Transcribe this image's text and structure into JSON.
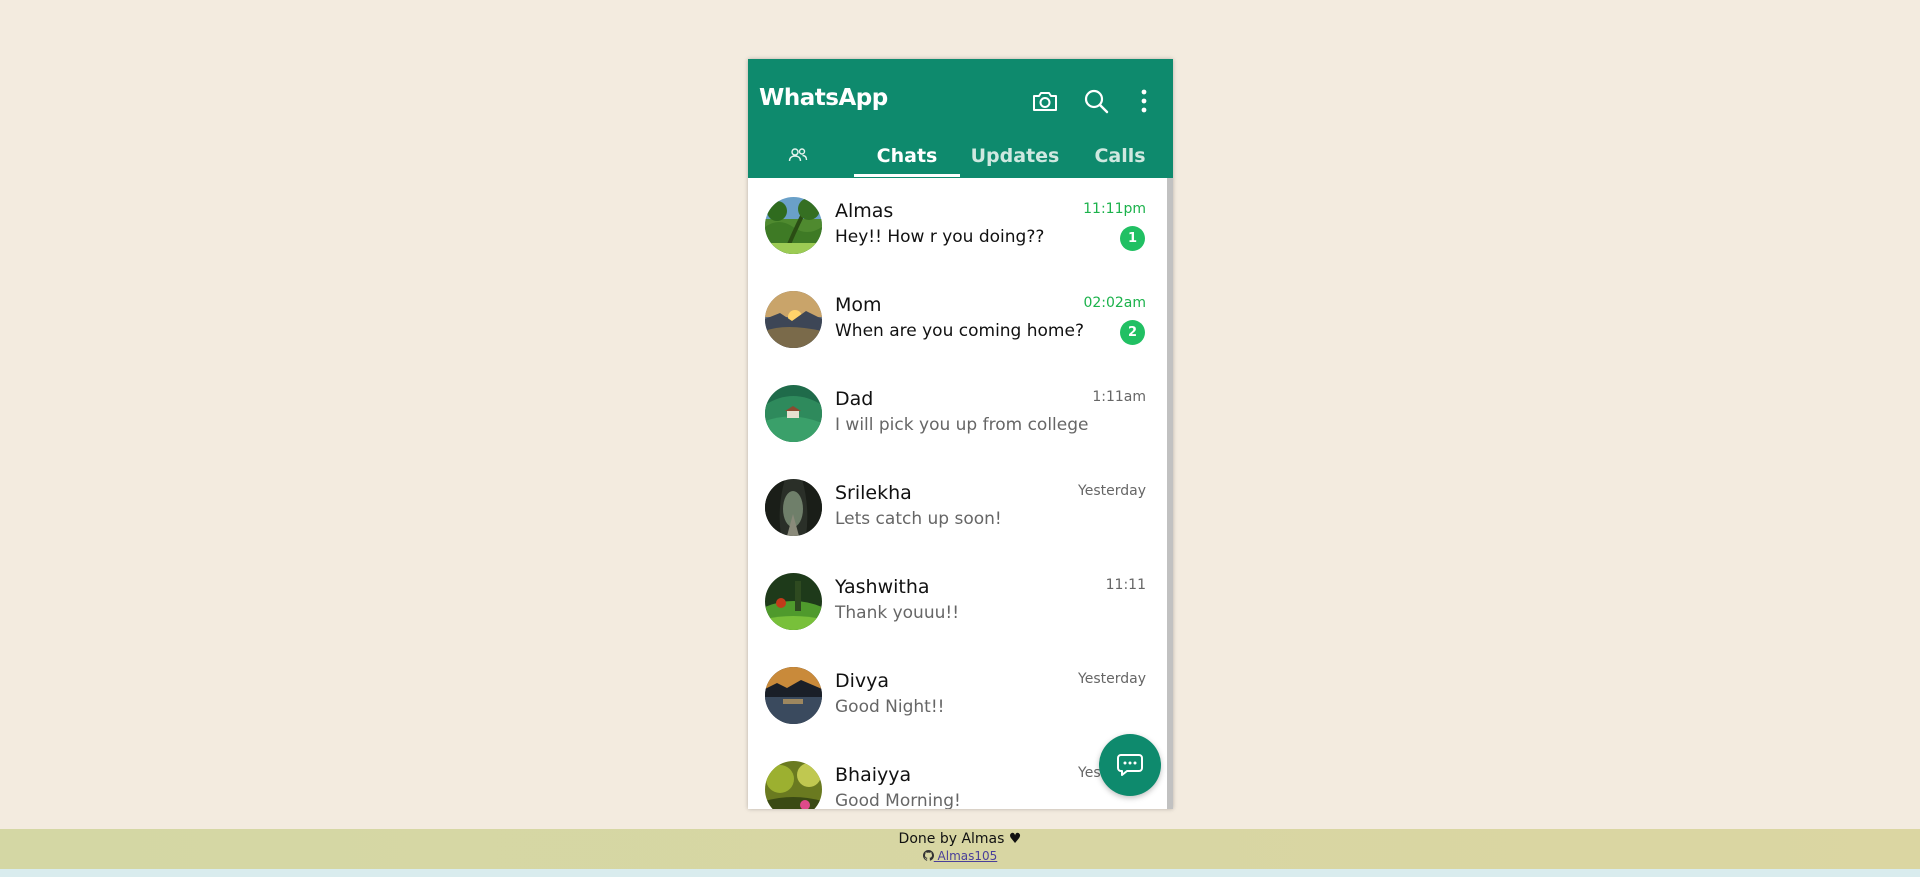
{
  "app": {
    "title": "WhatsApp"
  },
  "header": {
    "icons": [
      "camera-icon",
      "search-icon",
      "more-vertical-icon"
    ]
  },
  "tabs": [
    {
      "label": "",
      "icon": "community-icon",
      "active": false
    },
    {
      "label": "Chats",
      "active": true
    },
    {
      "label": "Updates",
      "active": false
    },
    {
      "label": "Calls",
      "active": false
    }
  ],
  "chats": [
    {
      "name": "Almas",
      "message": "Hey!! How r you doing??",
      "time": "11:11pm",
      "unread": "1"
    },
    {
      "name": "Mom",
      "message": "When are you coming home?",
      "time": "02:02am",
      "unread": "2"
    },
    {
      "name": "Dad",
      "message": "I will pick you up from college",
      "time": "1:11am",
      "unread": null
    },
    {
      "name": "Srilekha",
      "message": "Lets catch up soon!",
      "time": "Yesterday",
      "unread": null
    },
    {
      "name": "Yashwitha",
      "message": "Thank youuu!!",
      "time": "11:11",
      "unread": null
    },
    {
      "name": "Divya",
      "message": "Good Night!!",
      "time": "Yesterday",
      "unread": null
    },
    {
      "name": "Bhaiyya",
      "message": "Good Morning!",
      "time": "Yesterday",
      "unread": null
    }
  ],
  "footer": {
    "credit": "Done by Almas ♥",
    "link_label": " Almas105"
  },
  "colors": {
    "brand": "#0e8a6d",
    "unread_green": "#1bb24b",
    "badge_green": "#21c063",
    "page_bg": "#f3ebdf"
  }
}
